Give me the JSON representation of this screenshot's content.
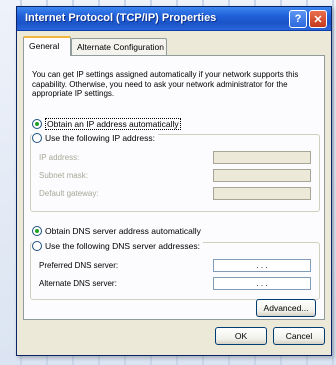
{
  "window": {
    "title": "Internet Protocol (TCP/IP) Properties",
    "help_label": "?",
    "close_label": "✕"
  },
  "tabs": [
    {
      "label": "General",
      "active": true
    },
    {
      "label": "Alternate Configuration",
      "active": false
    }
  ],
  "intro_text": "You can get IP settings assigned automatically if your network supports this capability. Otherwise, you need to ask your network administrator for the appropriate IP settings.",
  "ip": {
    "auto_label": "Obtain an IP address automatically",
    "auto_selected": true,
    "manual_label": "Use the following IP address:",
    "fields": [
      {
        "label": "IP address:",
        "value": ""
      },
      {
        "label": "Subnet mask:",
        "value": ""
      },
      {
        "label": "Default gateway:",
        "value": ""
      }
    ]
  },
  "dns": {
    "auto_label": "Obtain DNS server address automatically",
    "auto_selected": true,
    "manual_label": "Use the following DNS server addresses:",
    "fields": [
      {
        "label": "Preferred DNS server:",
        "value": ". . ."
      },
      {
        "label": "Alternate DNS server:",
        "value": ". . ."
      }
    ]
  },
  "buttons": {
    "advanced": "Advanced...",
    "ok": "OK",
    "cancel": "Cancel"
  },
  "colors": {
    "title_bar": "#1f5fd8",
    "dialog_bg": "#ece9d8",
    "tab_highlight": "#f2b53d",
    "radio_dot": "#21a121"
  }
}
